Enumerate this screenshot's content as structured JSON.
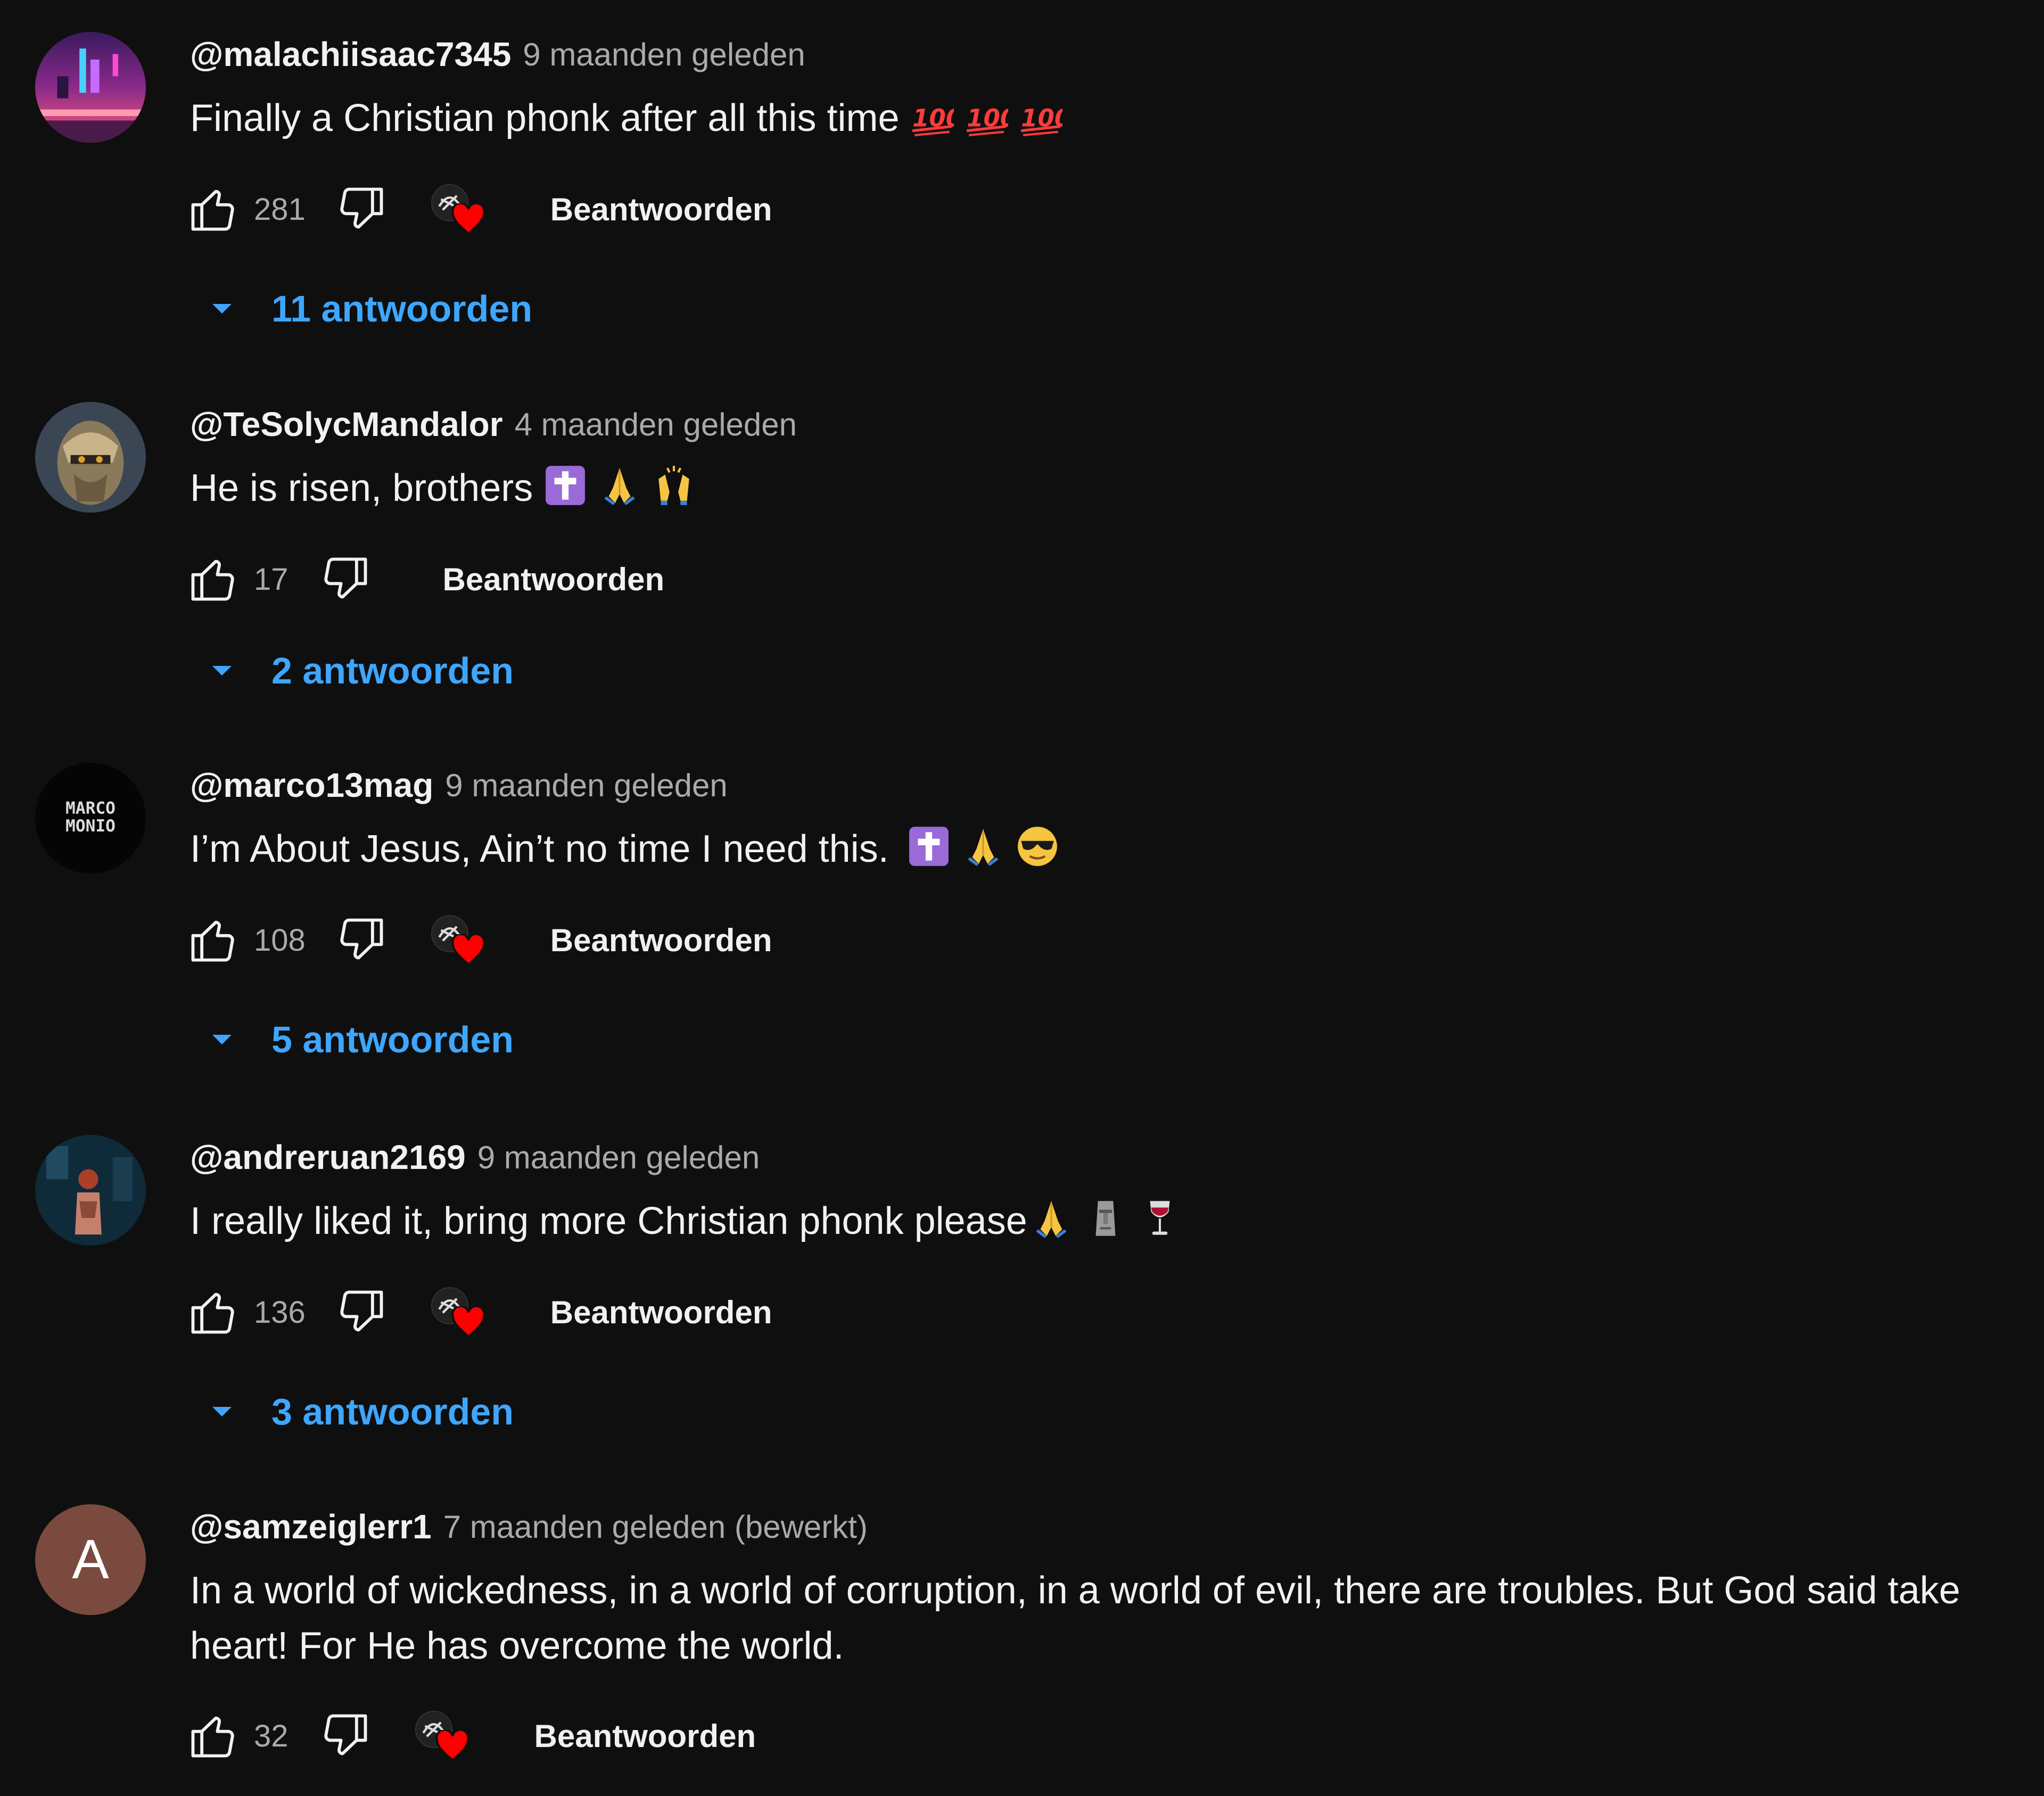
{
  "colors": {
    "background": "#0f0f0f",
    "link": "#3ea6ff",
    "muted": "#aaaaaa",
    "heart": "#ff0000"
  },
  "comments": [
    {
      "author": "@malachiisaac7345",
      "time": "9 maanden geleden",
      "text": "Finally a Christian phonk after all this time",
      "emojis": [
        "hundred-points",
        "hundred-points",
        "hundred-points"
      ],
      "likes": "281",
      "creator_heart": true,
      "reply_label": "Beantwoorden",
      "replies_label": "11 antwoorden",
      "avatar": "neon-city"
    },
    {
      "author": "@TeSolycMandalor",
      "time": "4 maanden geleden",
      "text": "He is risen, brothers",
      "emojis": [
        "latin-cross",
        "folded-hands",
        "raising-hands"
      ],
      "likes": "17",
      "creator_heart": false,
      "reply_label": "Beantwoorden",
      "replies_label": "2 antwoorden",
      "avatar": "armored-warrior"
    },
    {
      "author": "@marco13mag",
      "time": "9 maanden geleden",
      "text": "I’m About Jesus, Ain’t no time I need this.",
      "emojis": [
        "latin-cross",
        "folded-hands",
        "sunglasses-face"
      ],
      "likes": "108",
      "creator_heart": true,
      "reply_label": "Beantwoorden",
      "replies_label": "5 antwoorden",
      "avatar": "text-logo",
      "avatar_text": "MARCO MONIO"
    },
    {
      "author": "@andreruan2169",
      "time": "9 maanden geleden",
      "text": "I really liked it, bring more Christian phonk please",
      "emojis": [
        "folded-hands",
        "moai",
        "wine-glass"
      ],
      "likes": "136",
      "creator_heart": true,
      "reply_label": "Beantwoorden",
      "replies_label": "3 antwoorden",
      "avatar": "dark-figure"
    },
    {
      "author": "@samzeiglerr1",
      "time": "7 maanden geleden (bewerkt)",
      "text": "In a world of wickedness, in a world of corruption, in a world of evil, there are troubles. But God said take heart! For He has overcome the world.",
      "emojis": [],
      "likes": "32",
      "creator_heart": true,
      "reply_label": "Beantwoorden",
      "replies_label": "",
      "avatar": "letter",
      "avatar_letter": "A"
    }
  ]
}
